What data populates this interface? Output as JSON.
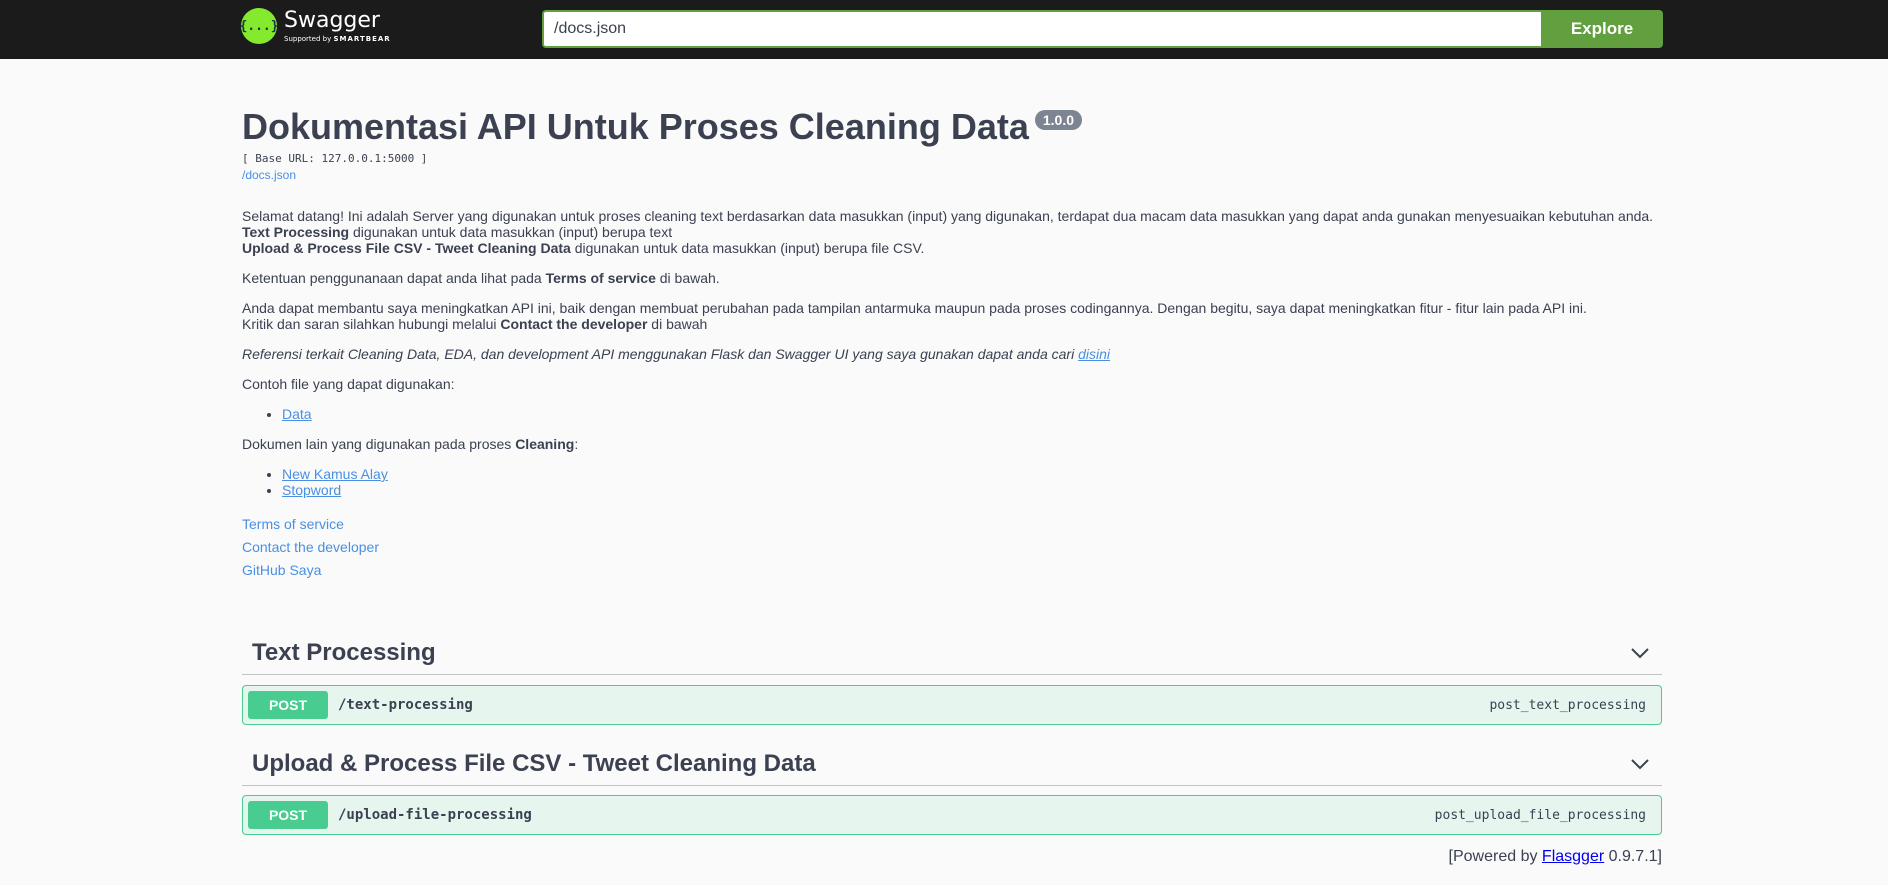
{
  "topbar": {
    "logo_name": "Swagger",
    "logo_glyph": "{...}",
    "logo_sub_prefix": "Supported by",
    "logo_sub_brand": "SMARTBEAR",
    "url_value": "/docs.json",
    "explore_label": "Explore"
  },
  "info": {
    "title": "Dokumentasi API Untuk Proses Cleaning Data",
    "version": "1.0.0",
    "base_url": "[ Base URL: 127.0.0.1:5000 ]",
    "spec_link": "/docs.json"
  },
  "description": {
    "intro": "Selamat datang! Ini adalah Server yang digunakan untuk proses cleaning text berdasarkan data masukkan (input) yang digunakan, terdapat dua macam data masukkan yang dapat anda gunakan menyesuaikan kebutuhan anda.",
    "line1_bold": "Text Processing",
    "line1_rest": " digunakan untuk data masukkan (input) berupa text",
    "line2_bold": "Upload & Process File CSV - Tweet Cleaning Data",
    "line2_rest": " digunakan untuk data masukkan (input) berupa file CSV.",
    "terms_pre": "Ketentuan penggunanaan dapat anda lihat pada ",
    "terms_bold": "Terms of service",
    "terms_post": " di bawah.",
    "help_line1": "Anda dapat membantu saya meningkatkan API ini, baik dengan membuat perubahan pada tampilan antarmuka maupun pada proses codingannya. Dengan begitu, saya dapat meningkatkan fitur - fitur lain pada API ini.",
    "help_line2_pre": "Kritik dan saran silahkan hubungi melalui ",
    "help_line2_bold": "Contact the developer",
    "help_line2_post": " di bawah",
    "ref_text": "Referensi terkait Cleaning Data, EDA, dan development API menggunakan Flask dan Swagger UI yang saya gunakan dapat anda cari ",
    "ref_link": "disini",
    "example_label": "Contoh file yang dapat digunakan:",
    "example_files": [
      "Data"
    ],
    "docs_label_pre": "Dokumen lain yang digunakan pada proses ",
    "docs_label_bold": "Cleaning",
    "docs_label_post": ":",
    "docs_files": [
      "New Kamus Alay",
      "Stopword"
    ]
  },
  "links": {
    "terms": "Terms of service",
    "contact": "Contact the developer",
    "github": "GitHub Saya"
  },
  "tags": [
    {
      "name": "Text Processing",
      "operations": [
        {
          "method": "POST",
          "path": "/text-processing",
          "operation_id": "post_text_processing"
        }
      ]
    },
    {
      "name": "Upload & Process File CSV - Tweet Cleaning Data",
      "operations": [
        {
          "method": "POST",
          "path": "/upload-file-processing",
          "operation_id": "post_upload_file_processing"
        }
      ]
    }
  ],
  "footer": {
    "prefix": "[Powered by ",
    "link": "Flasgger",
    "suffix": " 0.9.7.1]"
  },
  "colors": {
    "topbar": "#1b1b1b",
    "accent_green": "#62a03f",
    "post_green": "#49cc90",
    "link_blue": "#4990e2",
    "version_badge": "#7d8492"
  },
  "icons": {
    "logo": "swagger-logo-icon",
    "collapse": "chevron-down-icon"
  }
}
